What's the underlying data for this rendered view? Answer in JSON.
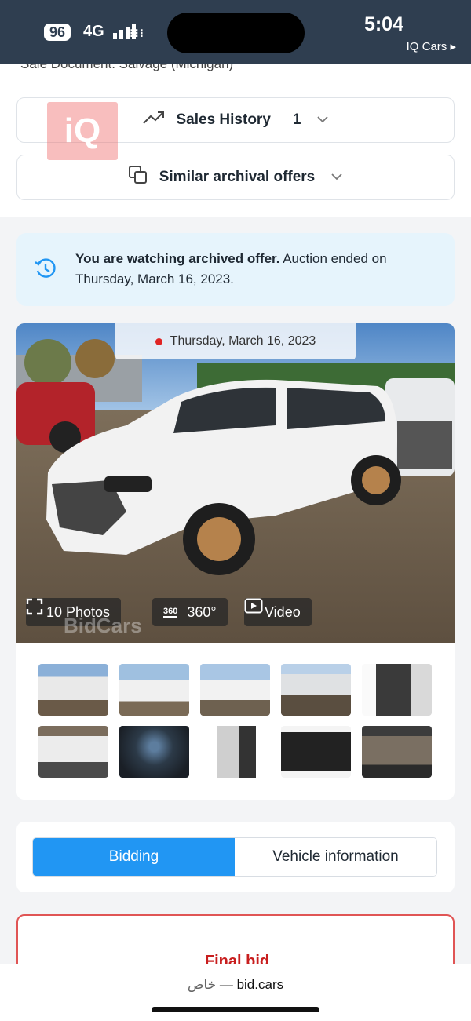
{
  "status_bar": {
    "battery": "96",
    "network": "4G",
    "time": "5:04",
    "back_app": "IQ Cars ▸"
  },
  "page": {
    "cut_off_text": "Sale Document: Salvage (Michigan)",
    "logo_text": "iQ",
    "sales_history": {
      "label": "Sales History",
      "count": "1",
      "icon": "trend-up-icon"
    },
    "similar_offers": {
      "label": "Similar archival offers",
      "icon": "copy-icon"
    },
    "notice": {
      "bold": "You are watching archived offer.",
      "rest": " Auction ended on Thursday, March 16, 2023."
    },
    "gallery": {
      "date": "Thursday, March 16, 2023",
      "photos_button": "10 Photos",
      "view360_button": "360°",
      "view360_badge": "360",
      "video_button": "Video",
      "watermark": "BidCars"
    },
    "tabs": [
      {
        "label": "Bidding",
        "active": true
      },
      {
        "label": "Vehicle information",
        "active": false
      }
    ],
    "final_bid_label": "Final bid"
  },
  "browser": {
    "private_label": "خاص",
    "separator": " — ",
    "domain": "bid.cars"
  },
  "colors": {
    "status_bar_bg": "#2f3e50",
    "accent_blue": "#2196f3",
    "notice_bg": "#e6f4fc",
    "final_bid_red": "#c81e1e"
  }
}
